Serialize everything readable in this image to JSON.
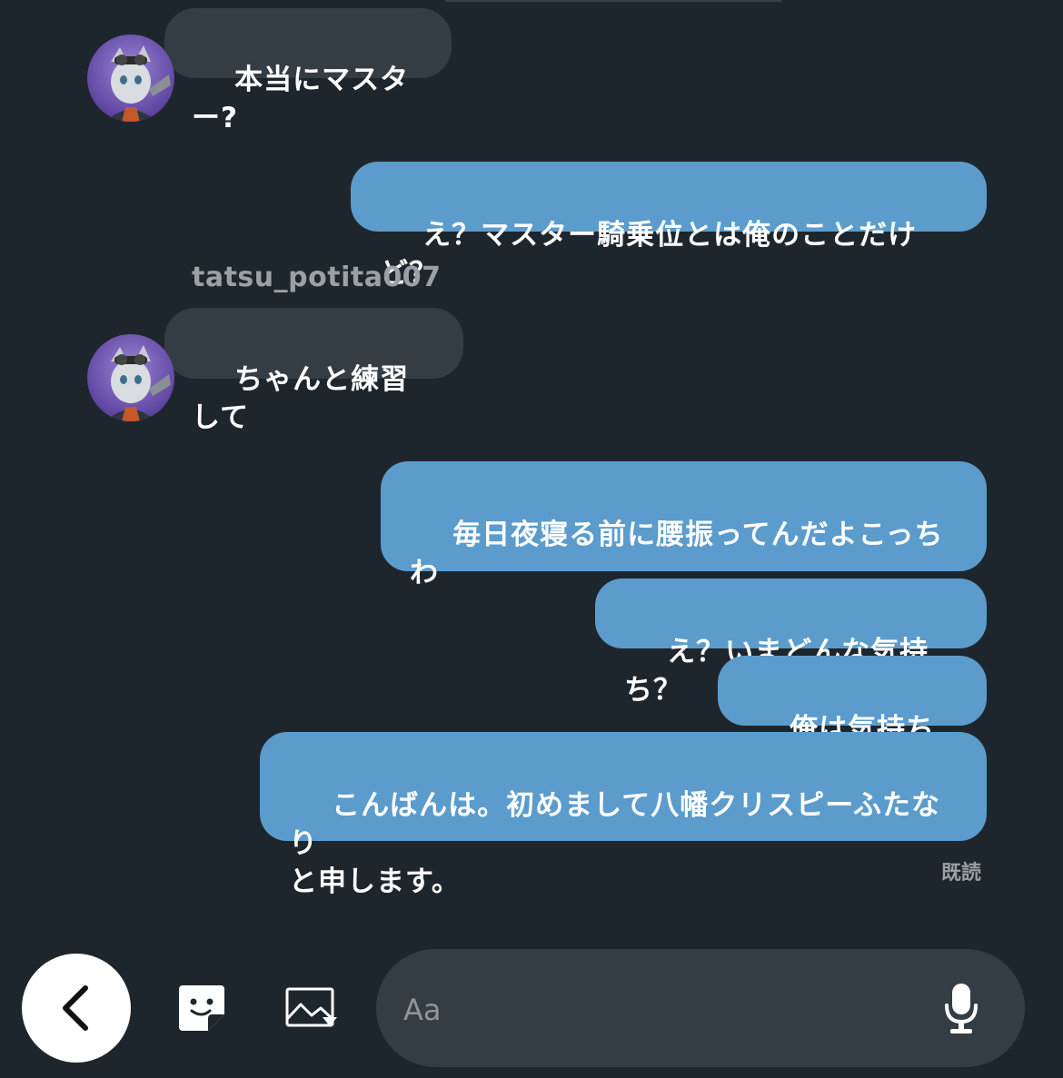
{
  "conversation": {
    "sender_name": "tatsu_potita007",
    "read_receipt": "既読",
    "messages": {
      "m1": "本当にマスター?",
      "m2": "え？マスター騎乗位とは俺のことだけど？",
      "m3": "ちゃんと練習して",
      "m4": "毎日夜寝る前に腰振ってんだよこっちわ",
      "m5": "え？いまどんな気持ち？",
      "m6": "俺は気持ちいい",
      "m7": "こんばんは。初めまして八幡クリスピーふたなり\nと申します。"
    }
  },
  "composer": {
    "placeholder": "Aa",
    "icons": [
      "back-icon",
      "sticker-icon",
      "image-icon",
      "microphone-icon"
    ]
  },
  "colors": {
    "background": "#1e262d",
    "incoming_bubble": "#343c44",
    "outgoing_bubble": "#5b9ccc",
    "muted_text": "#9aa0a6"
  }
}
